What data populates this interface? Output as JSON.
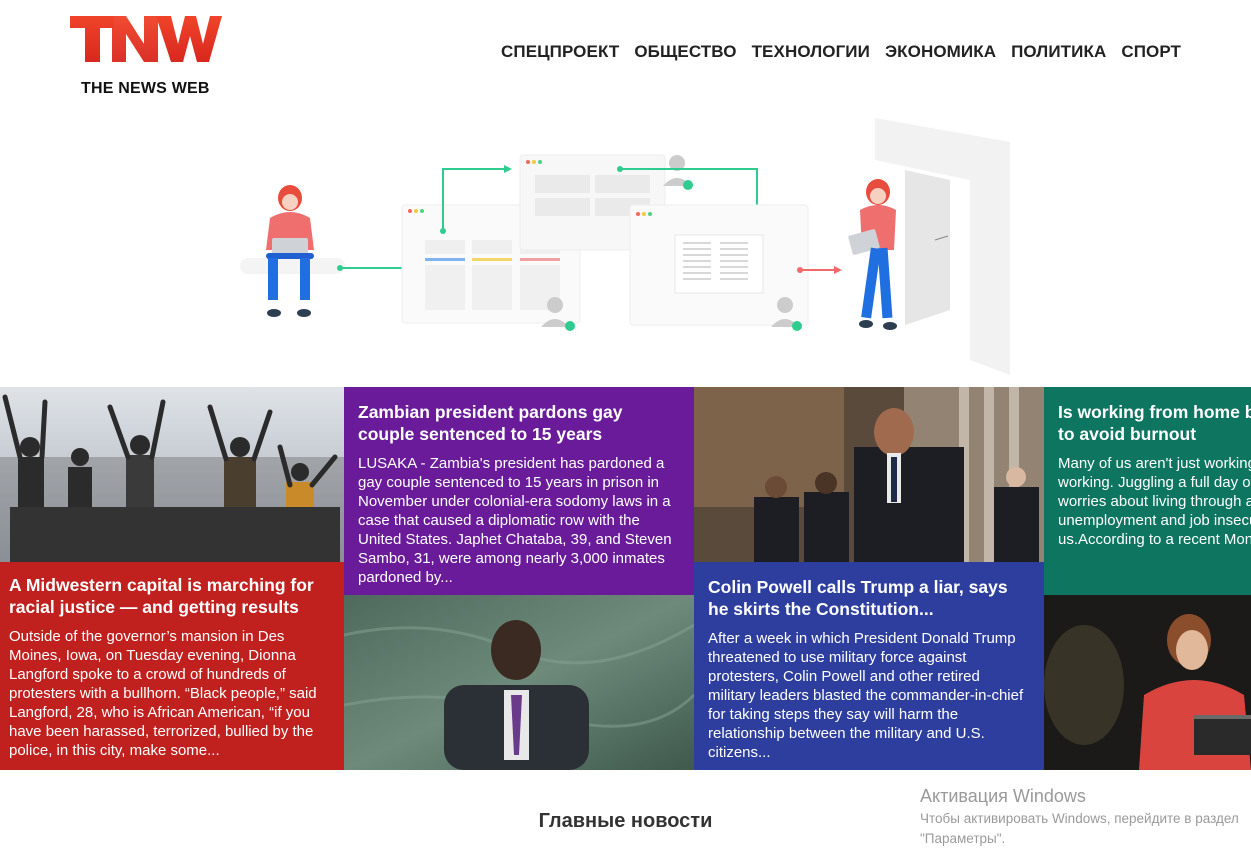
{
  "brand": {
    "logo_text": "TNW",
    "logo_subtitle": "THE NEWS WEB"
  },
  "nav": {
    "items": [
      "СПЕЦПРОЕКТ",
      "ОБЩЕСТВО",
      "ТЕХНОЛОГИИ",
      "ЭКОНОМИКА",
      "ПОЛИТИКА",
      "СПОРТ"
    ]
  },
  "articles": [
    {
      "title": "A Midwestern capital is marching for racial justice — and getting results",
      "excerpt": "Outside of the governor’s mansion in Des Moines, Iowa, on Tuesday evening, Dionna Langford spoke to a crowd of hundreds of protesters with a bullhorn. “Black people,” said Langford, 28, who is African American, “if you have been harassed, terrorized, bullied by the police, in this city, make some..."
    },
    {
      "title": "Zambian president pardons gay couple sentenced to 15 years",
      "excerpt": "LUSAKA - Zambia's president has pardoned a gay couple sentenced to 15 years in prison in November under colonial-era sodomy laws in a case that caused a diplomatic row with the United States. Japhet Chataba, 39, and Steven Sambo, 31, were among nearly 3,000 inmates pardoned by..."
    },
    {
      "title": "Colin Powell calls Trump a liar, says he skirts the Constitution...",
      "excerpt": "After a week in which President Donald Trump threatened to use military force against protesters, Colin Powell and other retired military leaders blasted the commander-in-chief for taking steps they say will harm the relationship between the military and U.S. citizens..."
    },
    {
      "title": "Is working from home burning you out? Do this to avoid burnout",
      "excerpt": "Many of us aren't just working from home — we're panic working. Juggling a full day of work and childcare — amid worries about living through a pandemic, plus unemployment and job insecurity — is weighing on us.According to a recent Monster.com survey, 51% of..."
    }
  ],
  "section": {
    "main_news": "Главные новости"
  },
  "windows": {
    "activate_title": "Активация Windows",
    "activate_text": "Чтобы активировать Windows, перейдите в раздел \"Параметры\"."
  },
  "colors": {
    "brand_red": "#e8322a",
    "tile_red": "#c0201e",
    "tile_purple": "#6a1b9a",
    "tile_blue": "#2e3e9e",
    "tile_teal": "#0d7560",
    "accent_green": "#2ecc8f"
  },
  "icons": [
    "logo-tnw",
    "person-laptop-illustration",
    "dashboard-window-illustration",
    "person-door-illustration",
    "user-avatar-icon"
  ]
}
